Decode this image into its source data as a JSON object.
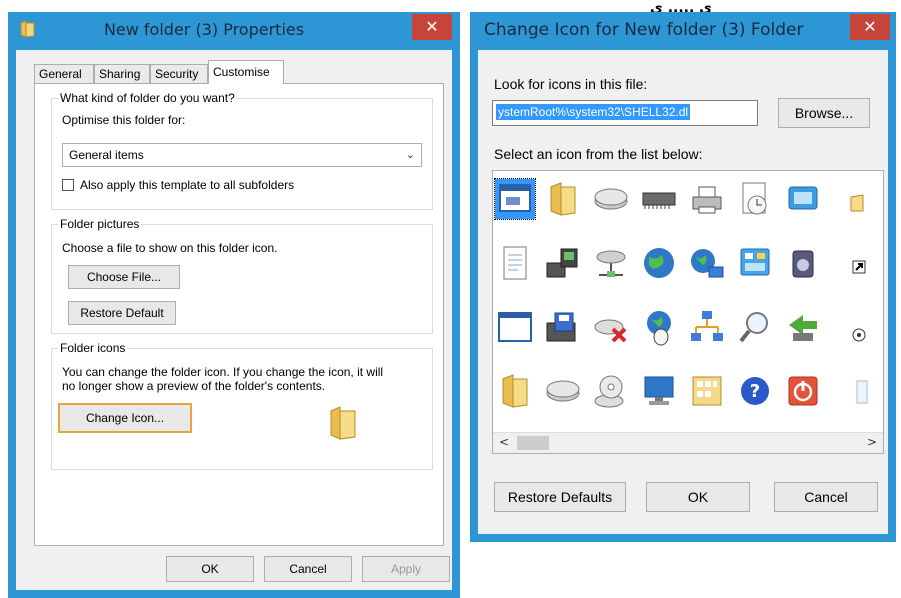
{
  "top_fragment": "ي ..... ي",
  "props": {
    "title": "New folder (3) Properties",
    "close": "✕",
    "tabs": [
      "General",
      "Sharing",
      "Security",
      "Customise"
    ],
    "kind": {
      "title": "What kind of folder do you want?",
      "optimise_label": "Optimise this folder for:",
      "select_value": "General items",
      "apply_template": "Also apply this template to all subfolders"
    },
    "pictures": {
      "title": "Folder pictures",
      "desc": "Choose a file to show on this folder icon.",
      "choose_file": "Choose File...",
      "restore_default": "Restore Default"
    },
    "icons": {
      "title": "Folder icons",
      "desc1": "You can change the folder icon. If you change the icon, it will",
      "desc2": "no longer show a preview of the folder's contents.",
      "change_icon": "Change Icon..."
    },
    "ok": "OK",
    "cancel": "Cancel",
    "apply": "Apply"
  },
  "icon_dialog": {
    "title": "Change Icon for New folder (3) Folder",
    "close": "✕",
    "look_label": "Look for icons in this file:",
    "file_path": "ystemRoot%\\system32\\SHELL32.dl",
    "browse": "Browse...",
    "select_label": "Select an icon from the list below:",
    "restore_defaults": "Restore Defaults",
    "ok": "OK",
    "cancel": "Cancel",
    "scroll_left": "<",
    "scroll_right": ">",
    "icons": [
      [
        "application-window-icon",
        "folder-icon",
        "drive-icon",
        "memory-chip-icon",
        "printer-icon",
        "clock-document-icon",
        "screen-icon",
        "folder-partial-icon"
      ],
      [
        "text-document-icon",
        "network-computer-icon",
        "network-server-icon",
        "globe-icon",
        "network-globe-icon",
        "control-panel-icon",
        "speaker-icon",
        "shortcut-arrow-icon"
      ],
      [
        "blank-window-icon",
        "floppy-computer-icon",
        "drive-delete-icon",
        "globe-mouse-icon",
        "network-tree-icon",
        "magnifier-icon",
        "network-arrow-icon",
        "options-icon"
      ],
      [
        "folder-icon",
        "drive-icon",
        "cd-drive-icon",
        "monitor-icon",
        "calculator-icon",
        "help-icon",
        "power-icon",
        "recycle-bin-partial-icon"
      ]
    ]
  },
  "colors": {
    "titlebar": "#2d96d4",
    "close": "#c7443a",
    "selection": "#3399ff",
    "focus": "#e8a33a"
  }
}
